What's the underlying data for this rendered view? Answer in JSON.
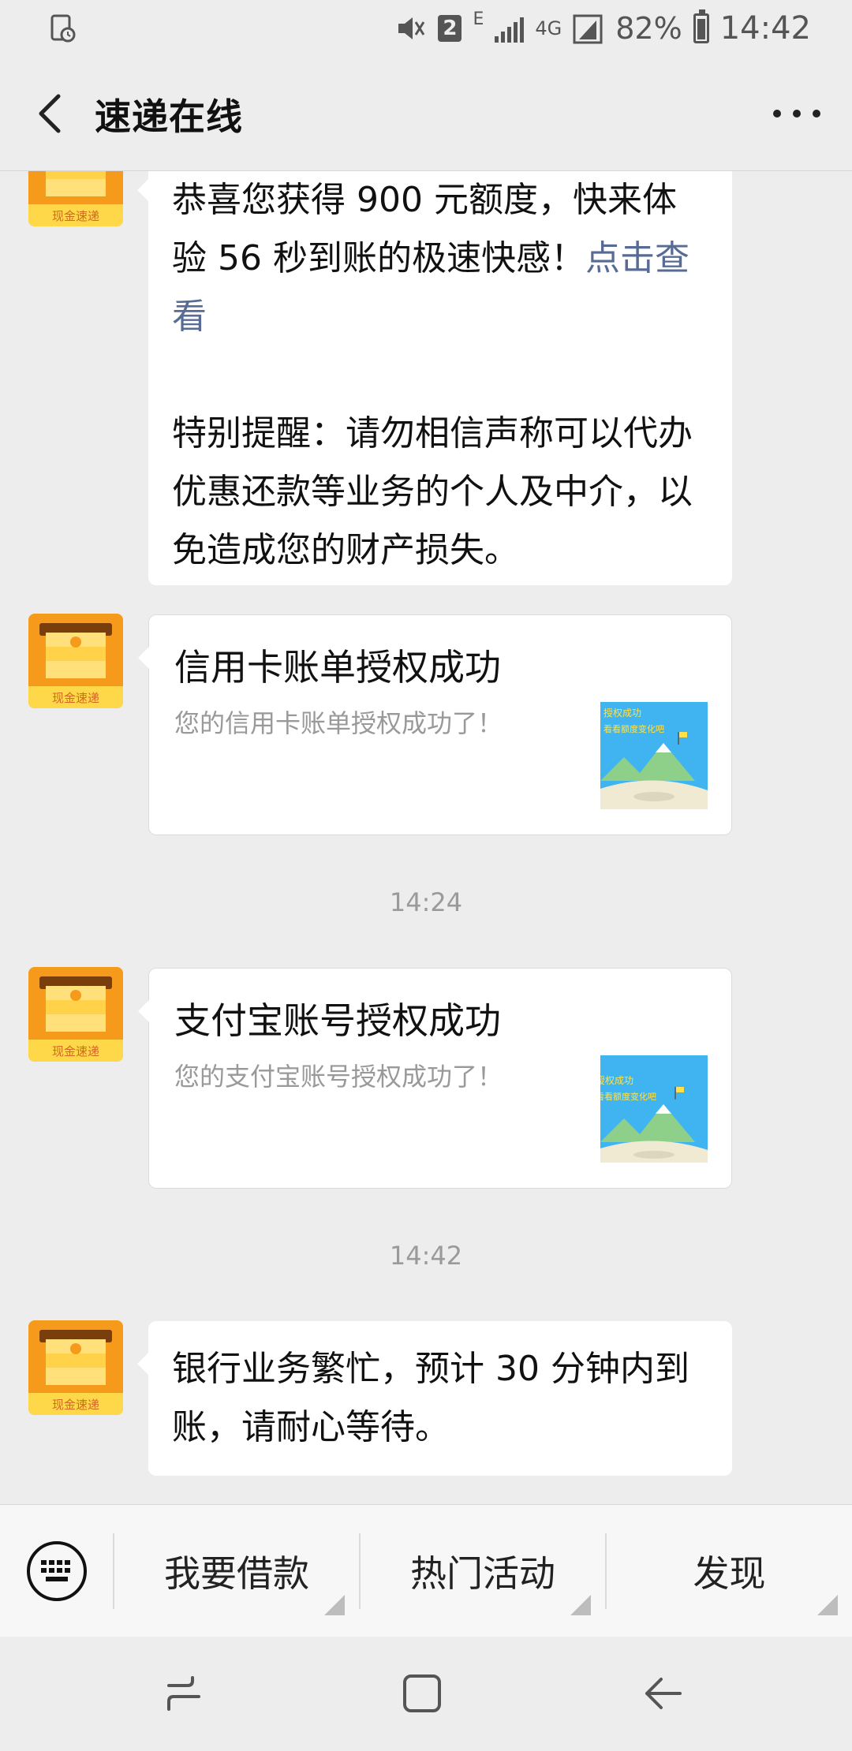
{
  "status_bar": {
    "notification_count": "2",
    "network_e": "E",
    "network_4g": "4G",
    "battery": "82%",
    "time": "14:42"
  },
  "header": {
    "title": "速递在线"
  },
  "messages": {
    "msg1": {
      "text_before_link": "恭喜您获得 900 元额度，快来体验 56 秒到账的极速快感！",
      "link_text": "点击查看",
      "reminder": "特别提醒：请勿相信声称可以代办优惠还款等业务的个人及中介，以免造成您的财产损失。"
    },
    "card1": {
      "title": "信用卡账单授权成功",
      "desc": "您的信用卡账单授权成功了！",
      "thumb_text1": "授权成功",
      "thumb_text2": "看看额度变化吧"
    },
    "time1": "14:24",
    "card2": {
      "title": "支付宝账号授权成功",
      "desc": "您的支付宝账号授权成功了！",
      "thumb_text1": "授权成功",
      "thumb_text2": "看看额度变化吧"
    },
    "time2": "14:42",
    "msg2": {
      "text": "银行业务繁忙，预计 30 分钟内到账，请耐心等待。"
    }
  },
  "avatar": {
    "label": "现金速递"
  },
  "menu": {
    "item1": "我要借款",
    "item2": "热门活动",
    "item3": "发现"
  },
  "colors": {
    "link": "#576b95",
    "avatar_orange": "#f59a1b",
    "background": "#ededed"
  }
}
